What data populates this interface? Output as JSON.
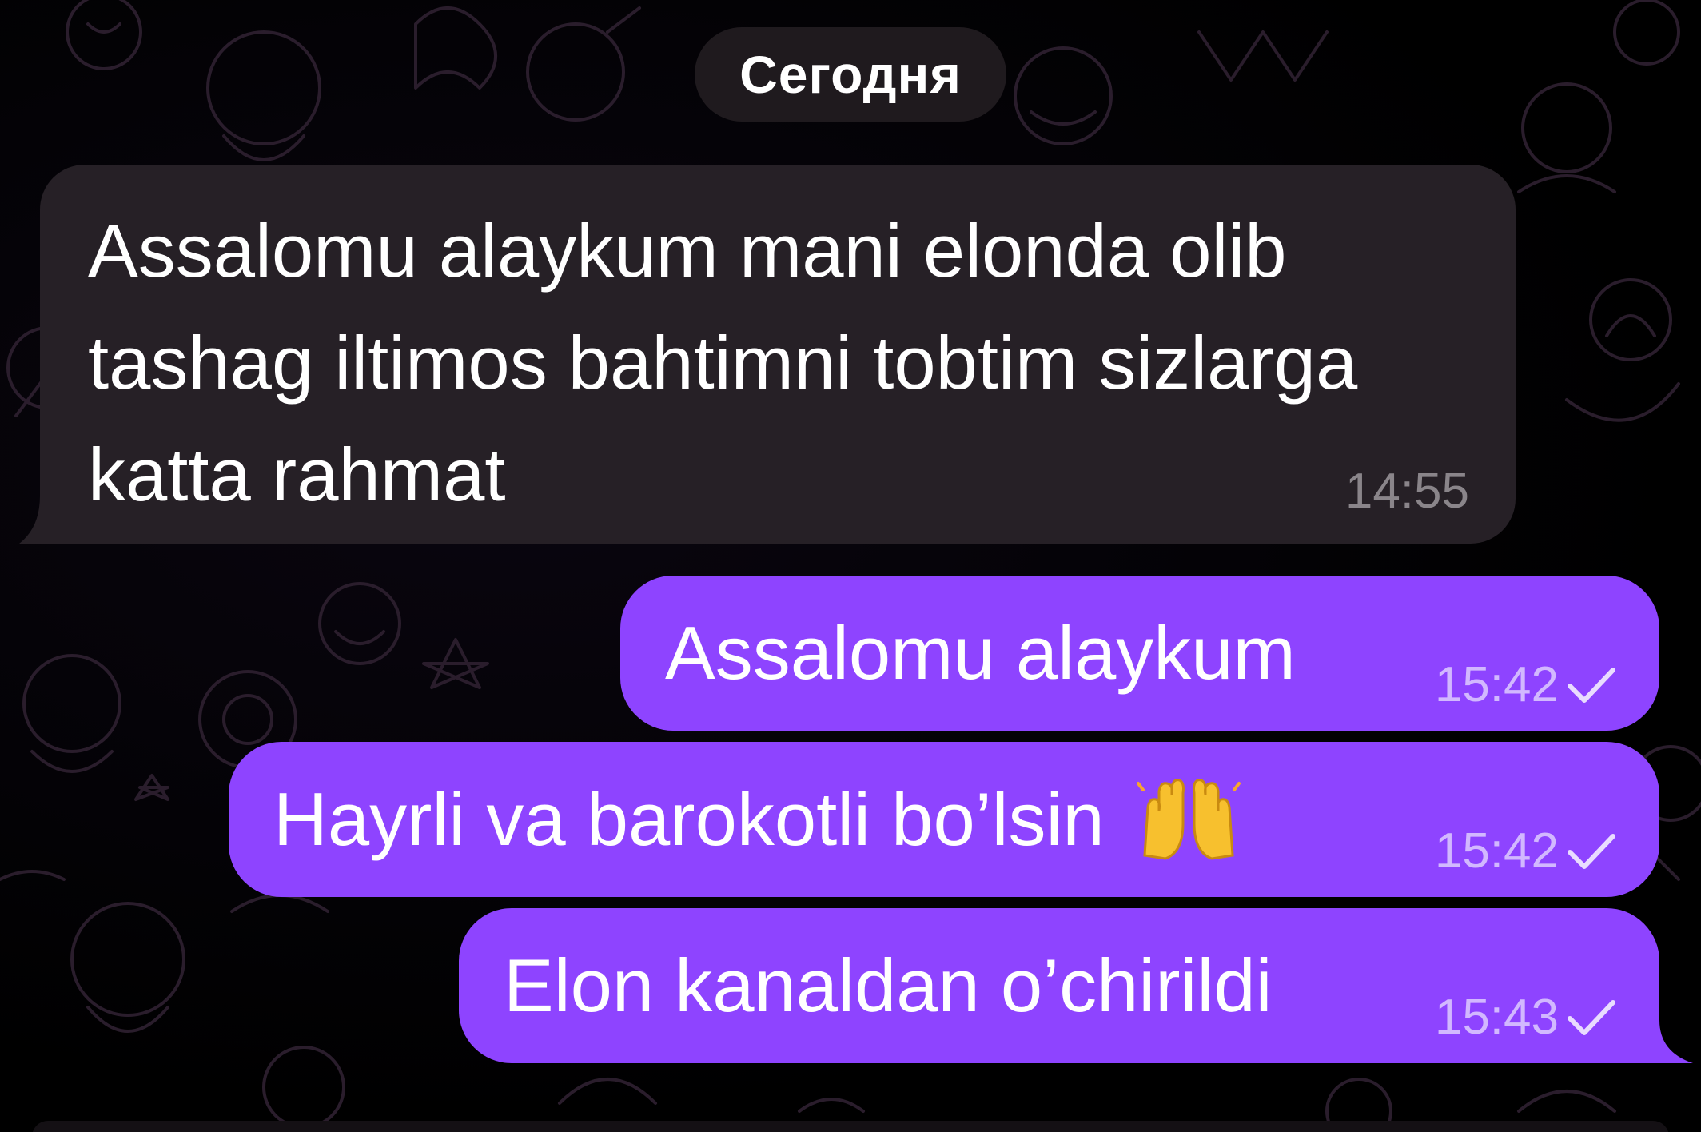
{
  "chat": {
    "date_separator": "Сегодня",
    "messages": [
      {
        "direction": "incoming",
        "text": "Assalomu alaykum mani elonda olib tashag iltimos bahtimni tobtim sizlarga katta rahmat",
        "time": "14:55"
      },
      {
        "direction": "outgoing",
        "text": "Assalomu alaykum",
        "time": "15:42",
        "status_icon": "check-icon"
      },
      {
        "direction": "outgoing",
        "text": "Hayrli va barokotli bo’lsin",
        "emoji": "raising-hands-emoji",
        "time": "15:42",
        "status_icon": "check-icon"
      },
      {
        "direction": "outgoing",
        "text": "Elon kanaldan o’chirildi",
        "time": "15:43",
        "status_icon": "check-icon"
      }
    ]
  },
  "colors": {
    "background": "#000000",
    "incoming_bubble": "#262026",
    "outgoing_bubble": "#8e44ff",
    "outgoing_time": "#d2b8ff",
    "incoming_time": "#8a858a",
    "doodle_stroke": "#2a1d2c"
  }
}
